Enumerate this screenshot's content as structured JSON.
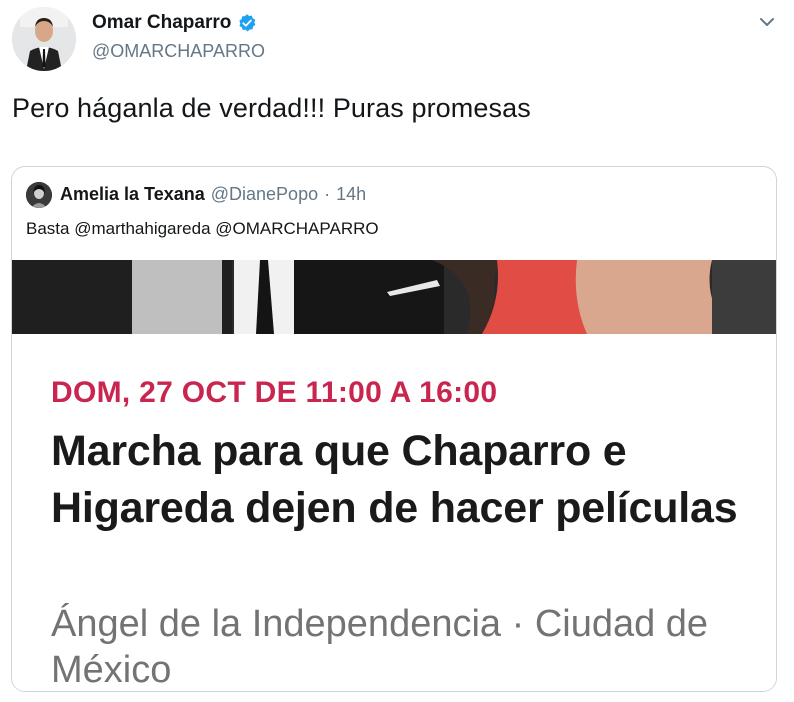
{
  "tweet": {
    "author_name": "Omar Chaparro",
    "author_handle": "@OMARCHAPARRO",
    "text": "Pero háganla de verdad!!! Puras promesas"
  },
  "quoted_tweet": {
    "author_name": "Amelia la Texana",
    "author_handle": "@DianePopo",
    "separator": "·",
    "time": "14h",
    "text": "Basta @marthahigareda @OMARCHAPARRO"
  },
  "event_card": {
    "date": "DOM, 27 OCT DE 11:00 A 16:00",
    "title": "Marcha para que Chaparro e Higareda dejen de hacer películas",
    "location": "Ángel de la Independencia · Ciudad de México"
  },
  "icons": {
    "verified": "verified-badge-icon",
    "menu": "chevron-down-icon"
  },
  "colors": {
    "verified_blue": "#1da1f2",
    "event_date_red": "#c8264f",
    "muted_gray": "#657786"
  }
}
